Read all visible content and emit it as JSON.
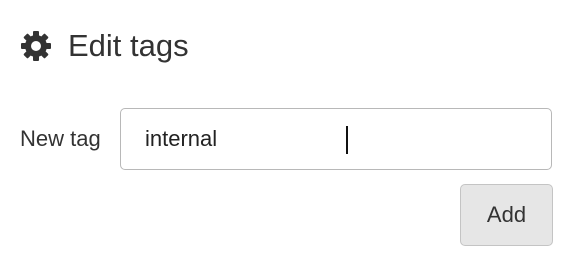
{
  "header": {
    "icon": "gear-icon",
    "title": "Edit tags"
  },
  "form": {
    "new_tag_label": "New tag",
    "new_tag_value": "internal",
    "new_tag_placeholder": ""
  },
  "actions": {
    "add_label": "Add"
  },
  "colors": {
    "text": "#333333",
    "input_border": "#b8b8b8",
    "button_bg": "#e6e6e6",
    "button_border": "#c4c4c4"
  }
}
